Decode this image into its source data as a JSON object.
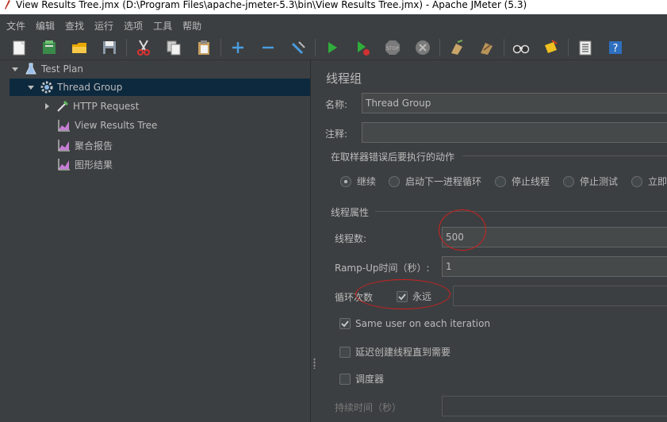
{
  "window": {
    "title": "View Results Tree.jmx (D:\\Program Files\\apache-jmeter-5.3\\bin\\View Results Tree.jmx) - Apache JMeter (5.3)"
  },
  "menu": [
    "文件",
    "编辑",
    "查找",
    "运行",
    "选项",
    "工具",
    "帮助"
  ],
  "toolbar": {
    "icons": [
      "new-icon",
      "templates-icon",
      "open-icon",
      "save-icon",
      "cut-icon",
      "copy-icon",
      "paste-icon",
      "expand-icon",
      "collapse-icon",
      "toggle-icon",
      "start-icon",
      "start-no-pause-icon",
      "stop-icon",
      "shutdown-icon",
      "clear-icon",
      "clear-all-icon",
      "search-icon",
      "reset-search-icon",
      "function-helper-icon",
      "help-icon"
    ]
  },
  "tree": {
    "items": [
      {
        "label": "Test Plan",
        "icon": "flask-icon"
      },
      {
        "label": "Thread Group",
        "icon": "gear-icon"
      },
      {
        "label": "HTTP Request",
        "icon": "pipette-icon"
      },
      {
        "label": "View Results Tree",
        "icon": "chart-icon"
      },
      {
        "label": "聚合报告",
        "icon": "chart-icon"
      },
      {
        "label": "图形结果",
        "icon": "chart-icon"
      }
    ]
  },
  "panel": {
    "title": "线程组",
    "name_label": "名称:",
    "name_value": "Thread Group",
    "comment_label": "注释:",
    "comment_value": "",
    "error_action": {
      "title": "在取样器错误后要执行的动作",
      "options": [
        "继续",
        "启动下一进程循环",
        "停止线程",
        "停止测试",
        "立即"
      ],
      "selected": "继续"
    },
    "thread_props": {
      "title": "线程属性",
      "threads_label": "线程数:",
      "threads_value": "500",
      "rampup_label": "Ramp-Up时间（秒）:",
      "rampup_value": "1",
      "loop_label": "循环次数",
      "forever_label": "永远",
      "forever_checked": true,
      "same_user_label": "Same user on each iteration",
      "same_user_checked": true,
      "delay_label": "延迟创建线程直到需要",
      "delay_checked": false,
      "scheduler_label": "调度器",
      "scheduler_checked": false,
      "duration_label": "持续时间（秒）",
      "duration_value": ""
    }
  },
  "colors": {
    "background": "#3c3f41",
    "selection": "#0d293e",
    "annotation": "#d02020"
  }
}
